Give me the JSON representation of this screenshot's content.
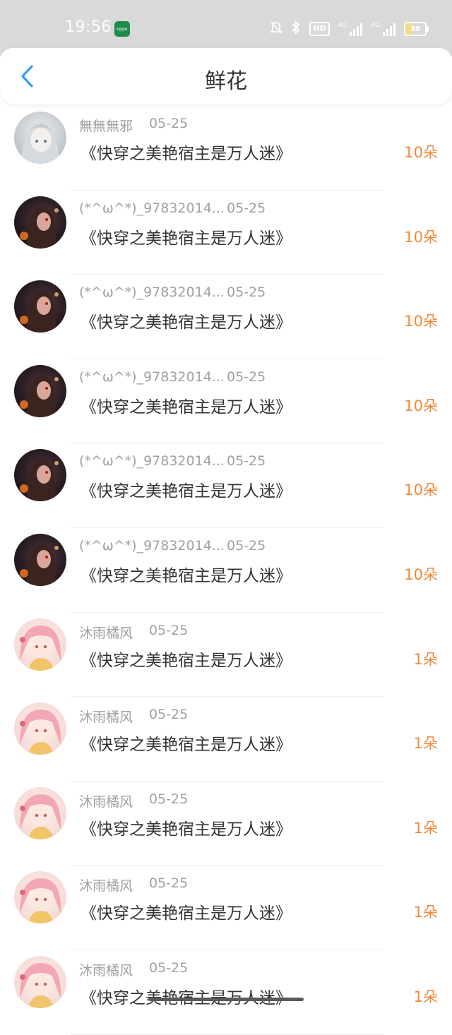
{
  "status_bar": {
    "time": "19:56",
    "app_icon_label": "oppo",
    "hd_label": "HD",
    "signal1_label": "4G",
    "signal2_label": "4G",
    "battery": "38"
  },
  "header": {
    "title": "鲜花",
    "back_icon": "chevron-left-icon"
  },
  "colors": {
    "accent": "#3a9bf0",
    "count": "#f08a3c",
    "meta_text": "#a0a0a0",
    "body_text": "#333333"
  },
  "items": [
    {
      "user": "無無無邪",
      "date": "05-25",
      "book": "《快穿之美艳宿主是万人迷》",
      "count": "10朵",
      "avatar": "silver"
    },
    {
      "user": "(*^ω^*)_97832014...",
      "date": "05-25",
      "book": "《快穿之美艳宿主是万人迷》",
      "count": "10朵",
      "avatar": "dark"
    },
    {
      "user": "(*^ω^*)_97832014...",
      "date": "05-25",
      "book": "《快穿之美艳宿主是万人迷》",
      "count": "10朵",
      "avatar": "dark"
    },
    {
      "user": "(*^ω^*)_97832014...",
      "date": "05-25",
      "book": "《快穿之美艳宿主是万人迷》",
      "count": "10朵",
      "avatar": "dark"
    },
    {
      "user": "(*^ω^*)_97832014...",
      "date": "05-25",
      "book": "《快穿之美艳宿主是万人迷》",
      "count": "10朵",
      "avatar": "dark"
    },
    {
      "user": "(*^ω^*)_97832014...",
      "date": "05-25",
      "book": "《快穿之美艳宿主是万人迷》",
      "count": "10朵",
      "avatar": "dark"
    },
    {
      "user": "沐雨橘风",
      "date": "05-25",
      "book": "《快穿之美艳宿主是万人迷》",
      "count": "1朵",
      "avatar": "pink"
    },
    {
      "user": "沐雨橘风",
      "date": "05-25",
      "book": "《快穿之美艳宿主是万人迷》",
      "count": "1朵",
      "avatar": "pink"
    },
    {
      "user": "沐雨橘风",
      "date": "05-25",
      "book": "《快穿之美艳宿主是万人迷》",
      "count": "1朵",
      "avatar": "pink"
    },
    {
      "user": "沐雨橘风",
      "date": "05-25",
      "book": "《快穿之美艳宿主是万人迷》",
      "count": "1朵",
      "avatar": "pink"
    },
    {
      "user": "沐雨橘风",
      "date": "05-25",
      "book": "《快穿之美艳宿主是万人迷》",
      "count": "1朵",
      "avatar": "pink"
    }
  ]
}
